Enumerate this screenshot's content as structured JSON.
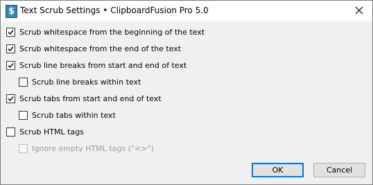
{
  "window": {
    "title": "Text Scrub Settings • ClipboardFusion Pro 5.0",
    "app_icon": "clipboardfusion-dollar-icon",
    "close_icon": "close-icon"
  },
  "options": [
    {
      "label": "Scrub whitespace from the beginning of the text",
      "checked": true,
      "enabled": true
    },
    {
      "label": "Scrub whitespace from the end of the text",
      "checked": true,
      "enabled": true
    },
    {
      "label": "Scrub line breaks from start and end of text",
      "checked": true,
      "enabled": true
    },
    {
      "label": "Scrub line breaks within text",
      "checked": false,
      "enabled": true
    },
    {
      "label": "Scrub tabs from start and end of text",
      "checked": true,
      "enabled": true
    },
    {
      "label": "Scrub tabs within text",
      "checked": false,
      "enabled": true
    },
    {
      "label": "Scrub HTML tags",
      "checked": false,
      "enabled": true
    },
    {
      "label": "Ignore empty HTML tags (\"<>\")",
      "checked": false,
      "enabled": false
    }
  ],
  "buttons": {
    "ok_label": "OK",
    "cancel_label": "Cancel"
  },
  "colors": {
    "accent": "#0078d7",
    "disabled_text": "#9a9a9a"
  }
}
